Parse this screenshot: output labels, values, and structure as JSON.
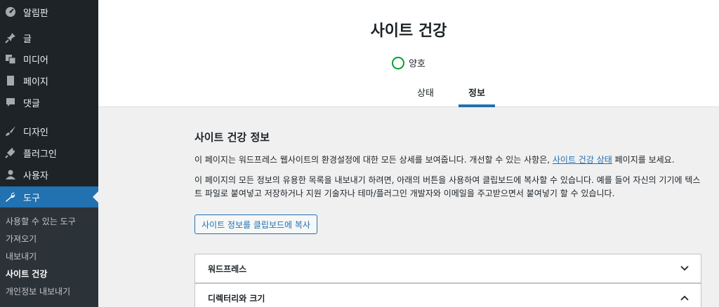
{
  "sidebar": {
    "items": [
      {
        "label": "알림판",
        "icon": "dashboard-icon"
      },
      {
        "label": "글",
        "icon": "pin-icon"
      },
      {
        "label": "미디어",
        "icon": "media-icon"
      },
      {
        "label": "페이지",
        "icon": "page-icon"
      },
      {
        "label": "댓글",
        "icon": "comment-icon"
      },
      {
        "label": "디자인",
        "icon": "brush-icon"
      },
      {
        "label": "플러그인",
        "icon": "plugin-icon"
      },
      {
        "label": "사용자",
        "icon": "user-icon"
      },
      {
        "label": "도구",
        "icon": "wrench-icon"
      }
    ],
    "submenu": [
      {
        "label": "사용할 수 있는 도구"
      },
      {
        "label": "가져오기"
      },
      {
        "label": "내보내기"
      },
      {
        "label": "사이트 건강"
      },
      {
        "label": "개인정보 내보내기"
      }
    ]
  },
  "header": {
    "title": "사이트 건강",
    "status": "양호",
    "tabs": [
      {
        "label": "상태"
      },
      {
        "label": "정보"
      }
    ]
  },
  "main": {
    "section_title": "사이트 건강 정보",
    "para1_before": "이 페이지는 워드프레스 웹사이트의 환경설정에 대한 모든 상세를 보여줍니다. 개선할 수 있는 사항은, ",
    "para1_link": "사이트 건강 상태",
    "para1_after": " 페이지를 보세요.",
    "para2": "이 페이지의 모든 정보의 유용한 목록을 내보내기 하려면, 아래의 버튼을 사용하여 클립보드에 복사할 수 있습니다. 예를 들어 자신의 기기에 텍스트 파일로 붙여넣고 저장하거나 지원 기술자나 테마/플러그인 개발자와 이메일을 주고받으면서 붙여넣기 할 수 있습니다.",
    "copy_button": "사이트 정보를 클립보드에 복사",
    "accordions": [
      {
        "label": "워드프레스",
        "state": "collapsed"
      },
      {
        "label": "디렉터리와 크기",
        "state": "expanded"
      }
    ]
  },
  "colors": {
    "sidebar_bg": "#1d2327",
    "accent": "#2271b1",
    "status_good": "#00a32a"
  }
}
